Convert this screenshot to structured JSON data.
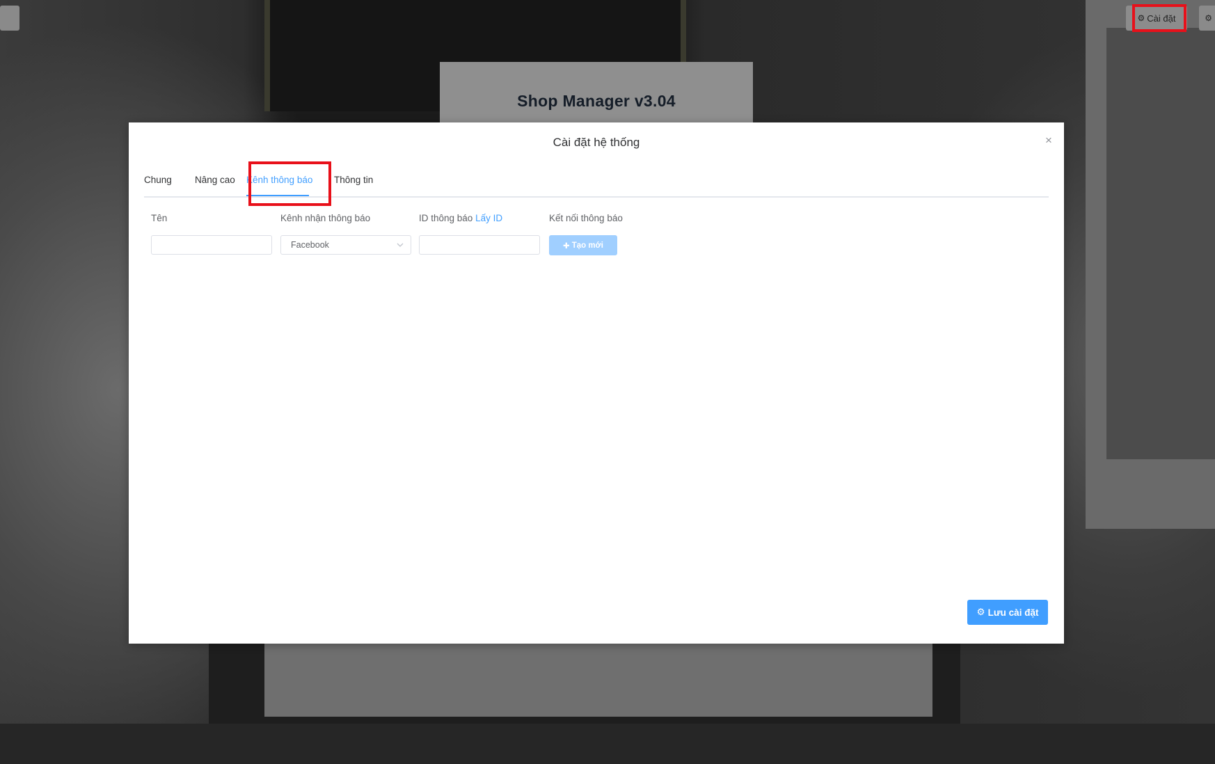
{
  "header": {
    "settings_button_label": "Cài đặt",
    "settings_icon": "gear-icon"
  },
  "app": {
    "title": "Shop Manager v3.04"
  },
  "modal": {
    "title": "Cài đặt hệ thống",
    "close_symbol": "×",
    "tabs": [
      {
        "label": "Chung",
        "active": false
      },
      {
        "label": "Nâng cao",
        "active": false
      },
      {
        "label": "Kênh thông báo",
        "active": true
      },
      {
        "label": "Thông tin",
        "active": false
      }
    ],
    "form": {
      "name_label": "Tên",
      "name_value": "",
      "channel_label": "Kênh nhận thông báo",
      "channel_value": "Facebook",
      "id_label": "ID thông báo",
      "id_link": "Lấy ID",
      "id_value": "",
      "connect_label": "Kết nối thông báo",
      "create_button_label": "Tạo mới",
      "create_icon": "plus-icon"
    },
    "save_button_label": "Lưu cài đặt",
    "save_icon": "gear-icon"
  },
  "colors": {
    "accent": "#409eff",
    "accent_disabled": "#a0cfff",
    "highlight_box": "#e8101a"
  }
}
